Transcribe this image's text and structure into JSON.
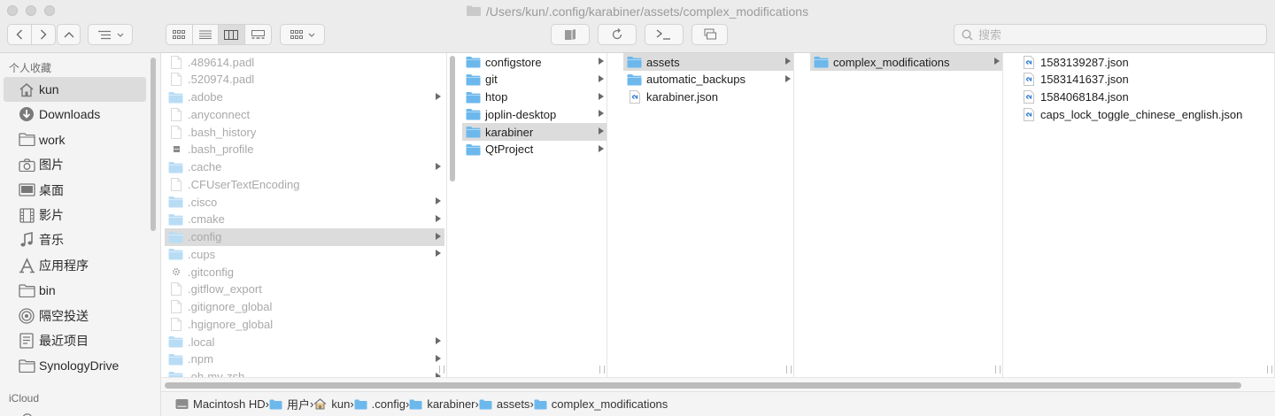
{
  "window": {
    "title": "/Users/kun/.config/karabiner/assets/complex_modifications"
  },
  "toolbar": {
    "search_placeholder": "搜索"
  },
  "sidebar": {
    "favorites_header": "个人收藏",
    "items": [
      {
        "label": "kun",
        "icon": "home-icon",
        "selected": true
      },
      {
        "label": "Downloads",
        "icon": "download-icon"
      },
      {
        "label": "work",
        "icon": "folder-icon"
      },
      {
        "label": "图片",
        "icon": "camera-icon"
      },
      {
        "label": "桌面",
        "icon": "desktop-icon"
      },
      {
        "label": "影片",
        "icon": "film-icon"
      },
      {
        "label": "音乐",
        "icon": "music-icon"
      },
      {
        "label": "应用程序",
        "icon": "applications-icon"
      },
      {
        "label": "bin",
        "icon": "folder-icon"
      },
      {
        "label": "隔空投送",
        "icon": "airdrop-icon"
      },
      {
        "label": "最近项目",
        "icon": "recents-icon"
      },
      {
        "label": "SynologyDrive",
        "icon": "folder-icon"
      }
    ],
    "icloud_header": "iCloud"
  },
  "columns": [
    {
      "items": [
        {
          "name": ".489614.padl",
          "type": "file",
          "hidden": true
        },
        {
          "name": ".520974.padl",
          "type": "file",
          "hidden": true
        },
        {
          "name": ".adobe",
          "type": "folder",
          "hidden": true,
          "arrow": true
        },
        {
          "name": ".anyconnect",
          "type": "file",
          "hidden": true
        },
        {
          "name": ".bash_history",
          "type": "file",
          "hidden": true
        },
        {
          "name": ".bash_profile",
          "type": "exec",
          "hidden": true
        },
        {
          "name": ".cache",
          "type": "folder",
          "hidden": true,
          "arrow": true
        },
        {
          "name": ".CFUserTextEncoding",
          "type": "file",
          "hidden": true
        },
        {
          "name": ".cisco",
          "type": "folder",
          "hidden": true,
          "arrow": true
        },
        {
          "name": ".cmake",
          "type": "folder",
          "hidden": true,
          "arrow": true
        },
        {
          "name": ".config",
          "type": "folder",
          "hidden": true,
          "arrow": true,
          "selected": true
        },
        {
          "name": ".cups",
          "type": "folder",
          "hidden": true,
          "arrow": true
        },
        {
          "name": ".gitconfig",
          "type": "gear",
          "hidden": true
        },
        {
          "name": ".gitflow_export",
          "type": "file",
          "hidden": true
        },
        {
          "name": ".gitignore_global",
          "type": "file",
          "hidden": true
        },
        {
          "name": ".hgignore_global",
          "type": "file",
          "hidden": true
        },
        {
          "name": ".local",
          "type": "folder",
          "hidden": true,
          "arrow": true
        },
        {
          "name": ".npm",
          "type": "folder",
          "hidden": true,
          "arrow": true
        },
        {
          "name": ".oh-my-zsh",
          "type": "folder",
          "hidden": true,
          "arrow": true
        }
      ]
    },
    {
      "items": [
        {
          "name": "configstore",
          "type": "folder",
          "arrow": true
        },
        {
          "name": "git",
          "type": "folder",
          "arrow": true
        },
        {
          "name": "htop",
          "type": "folder",
          "arrow": true
        },
        {
          "name": "joplin-desktop",
          "type": "folder",
          "arrow": true
        },
        {
          "name": "karabiner",
          "type": "folder",
          "arrow": true,
          "selected": true
        },
        {
          "name": "QtProject",
          "type": "folder",
          "arrow": true
        }
      ]
    },
    {
      "items": [
        {
          "name": "assets",
          "type": "folder",
          "arrow": true,
          "selected": true
        },
        {
          "name": "automatic_backups",
          "type": "folder",
          "arrow": true
        },
        {
          "name": "karabiner.json",
          "type": "json"
        }
      ]
    },
    {
      "items": [
        {
          "name": "complex_modifications",
          "type": "folder",
          "arrow": true,
          "selected": true
        }
      ]
    },
    {
      "items": [
        {
          "name": "1583139287.json",
          "type": "json"
        },
        {
          "name": "1583141637.json",
          "type": "json"
        },
        {
          "name": "1584068184.json",
          "type": "json"
        },
        {
          "name": "caps_lock_toggle_chinese_english.json",
          "type": "json"
        }
      ]
    }
  ],
  "path_bar": [
    {
      "label": "Macintosh HD",
      "icon": "disk-icon"
    },
    {
      "label": "用户",
      "icon": "folder-icon"
    },
    {
      "label": "kun",
      "icon": "home-icon"
    },
    {
      "label": ".config",
      "icon": "folder-icon"
    },
    {
      "label": "karabiner",
      "icon": "folder-icon"
    },
    {
      "label": "assets",
      "icon": "folder-icon"
    },
    {
      "label": "complex_modifications",
      "icon": "folder-icon"
    }
  ],
  "colors": {
    "folder": "#6cb8ec",
    "folder_hidden": "#b9dcf5",
    "selection": "#dcdcdc",
    "json_icon": "#2f7fd4"
  }
}
